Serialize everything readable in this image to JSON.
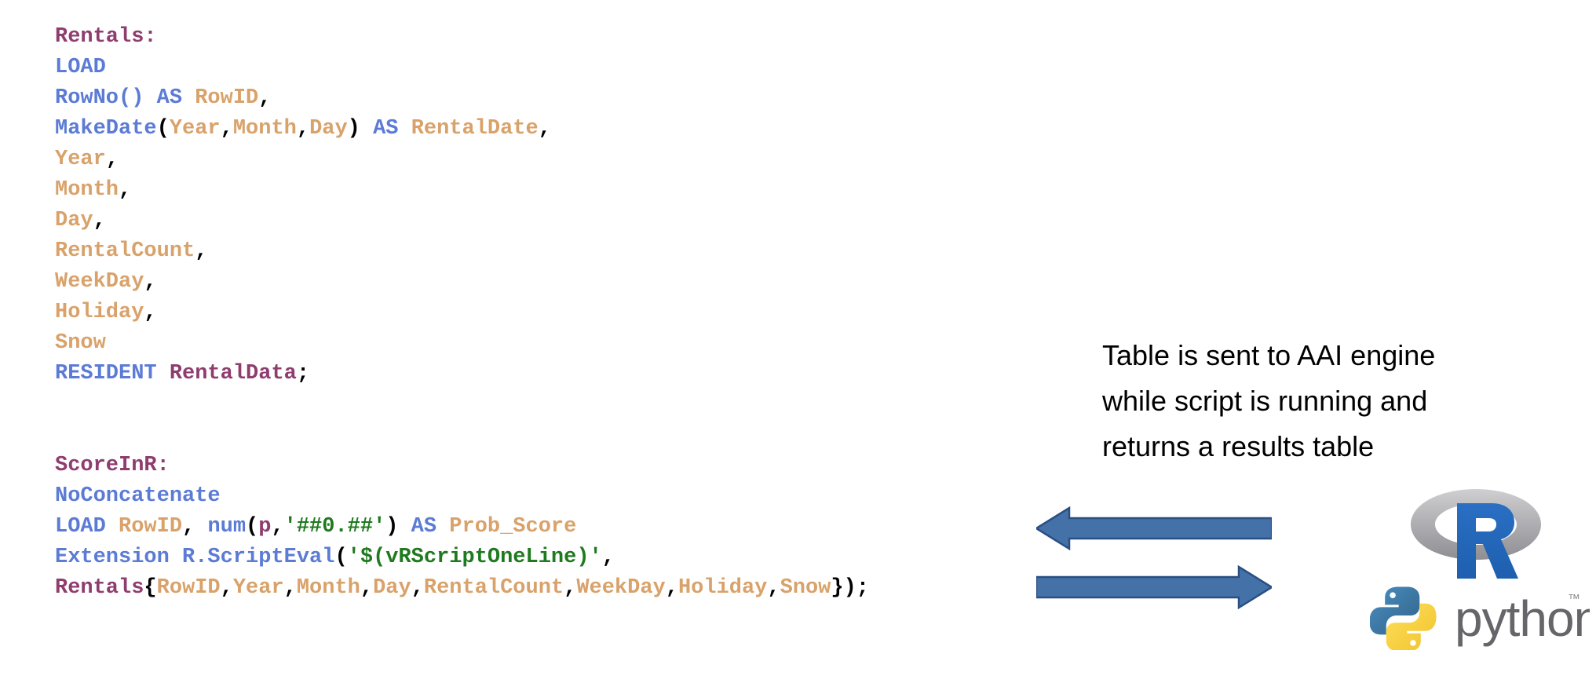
{
  "code": {
    "language": "Qlik load script",
    "lines": [
      {
        "id": "line-rentals-label",
        "tokens": [
          {
            "t": "Rentals:",
            "c": "table"
          }
        ]
      },
      {
        "id": "line-load",
        "tokens": [
          {
            "t": "LOAD",
            "c": "kw"
          }
        ]
      },
      {
        "id": "line-rowno",
        "tokens": [
          {
            "t": "RowNo() AS ",
            "c": "kw"
          },
          {
            "t": "RowID",
            "c": "field"
          },
          {
            "t": ",",
            "c": "punct"
          }
        ]
      },
      {
        "id": "line-makedate",
        "tokens": [
          {
            "t": "MakeDate",
            "c": "kw"
          },
          {
            "t": "(",
            "c": "punct"
          },
          {
            "t": "Year",
            "c": "field"
          },
          {
            "t": ",",
            "c": "punct"
          },
          {
            "t": "Month",
            "c": "field"
          },
          {
            "t": ",",
            "c": "punct"
          },
          {
            "t": "Day",
            "c": "field"
          },
          {
            "t": ")",
            "c": "punct"
          },
          {
            "t": " AS ",
            "c": "kw"
          },
          {
            "t": "RentalDate",
            "c": "field"
          },
          {
            "t": ",",
            "c": "punct"
          }
        ]
      },
      {
        "id": "line-year",
        "tokens": [
          {
            "t": "Year",
            "c": "field"
          },
          {
            "t": ",",
            "c": "punct"
          }
        ]
      },
      {
        "id": "line-month",
        "tokens": [
          {
            "t": "Month",
            "c": "field"
          },
          {
            "t": ",",
            "c": "punct"
          }
        ]
      },
      {
        "id": "line-day",
        "tokens": [
          {
            "t": "Day",
            "c": "field"
          },
          {
            "t": ",",
            "c": "punct"
          }
        ]
      },
      {
        "id": "line-rentalcount",
        "tokens": [
          {
            "t": "RentalCount",
            "c": "field"
          },
          {
            "t": ",",
            "c": "punct"
          }
        ]
      },
      {
        "id": "line-weekday",
        "tokens": [
          {
            "t": "WeekDay",
            "c": "field"
          },
          {
            "t": ",",
            "c": "punct"
          }
        ]
      },
      {
        "id": "line-holiday",
        "tokens": [
          {
            "t": "Holiday",
            "c": "field"
          },
          {
            "t": ",",
            "c": "punct"
          }
        ]
      },
      {
        "id": "line-snow",
        "tokens": [
          {
            "t": "Snow",
            "c": "field"
          }
        ]
      },
      {
        "id": "line-resident",
        "tokens": [
          {
            "t": "RESIDENT ",
            "c": "kw"
          },
          {
            "t": "RentalData",
            "c": "table"
          },
          {
            "t": ";",
            "c": "punct"
          }
        ]
      },
      {
        "id": "line-blank-1",
        "tokens": []
      },
      {
        "id": "line-blank-2",
        "tokens": []
      },
      {
        "id": "line-scoreinr-label",
        "tokens": [
          {
            "t": "ScoreInR:",
            "c": "table"
          }
        ]
      },
      {
        "id": "line-noconcatenate",
        "tokens": [
          {
            "t": "NoConcatenate",
            "c": "kw"
          }
        ]
      },
      {
        "id": "line-load-rowid",
        "tokens": [
          {
            "t": "LOAD ",
            "c": "kw"
          },
          {
            "t": "RowID",
            "c": "field"
          },
          {
            "t": ", ",
            "c": "punct"
          },
          {
            "t": "num",
            "c": "kw"
          },
          {
            "t": "(",
            "c": "punct"
          },
          {
            "t": "p",
            "c": "table"
          },
          {
            "t": ",",
            "c": "punct"
          },
          {
            "t": "'##0.##'",
            "c": "str"
          },
          {
            "t": ")",
            "c": "punct"
          },
          {
            "t": " AS ",
            "c": "kw"
          },
          {
            "t": "Prob_Score",
            "c": "field"
          }
        ]
      },
      {
        "id": "line-extension",
        "tokens": [
          {
            "t": "Extension R.ScriptEval",
            "c": "kw"
          },
          {
            "t": "(",
            "c": "punct"
          },
          {
            "t": "'$(vRScriptOneLine)'",
            "c": "str"
          },
          {
            "t": ",",
            "c": "punct"
          }
        ]
      },
      {
        "id": "line-rentals-fields",
        "tokens": [
          {
            "t": "Rentals",
            "c": "table"
          },
          {
            "t": "{",
            "c": "punct"
          },
          {
            "t": "RowID",
            "c": "field"
          },
          {
            "t": ",",
            "c": "punct"
          },
          {
            "t": "Year",
            "c": "field"
          },
          {
            "t": ",",
            "c": "punct"
          },
          {
            "t": "Month",
            "c": "field"
          },
          {
            "t": ",",
            "c": "punct"
          },
          {
            "t": "Day",
            "c": "field"
          },
          {
            "t": ",",
            "c": "punct"
          },
          {
            "t": "RentalCount",
            "c": "field"
          },
          {
            "t": ",",
            "c": "punct"
          },
          {
            "t": "WeekDay",
            "c": "field"
          },
          {
            "t": ",",
            "c": "punct"
          },
          {
            "t": "Holiday",
            "c": "field"
          },
          {
            "t": ",",
            "c": "punct"
          },
          {
            "t": "Snow",
            "c": "field"
          },
          {
            "t": "});",
            "c": "punct"
          }
        ]
      }
    ],
    "colors": {
      "table": "#8e3d6e",
      "keyword": "#5b7bd5",
      "field": "#d9a26a",
      "string": "#1f7a1f",
      "punctuation": "#000000"
    }
  },
  "annotation": {
    "line1": "Table is sent to AAI engine",
    "line2": "while script is running and",
    "line3": "returns a results table",
    "color": "#000000"
  },
  "arrows": [
    {
      "name": "arrow-left",
      "direction": "left",
      "color": "#4472a8",
      "outline": "#2a4f82"
    },
    {
      "name": "arrow-right",
      "direction": "right",
      "color": "#4472a8",
      "outline": "#2a4f82"
    }
  ],
  "logos": {
    "r": {
      "label": "R",
      "letter_color": "#1f65b7",
      "ring_color": "#b3b3b3"
    },
    "python": {
      "label": "python",
      "trademark": "™",
      "snake_blue": "#376f9f",
      "snake_yellow": "#f5ce3e",
      "text_color": "#66666a"
    }
  }
}
